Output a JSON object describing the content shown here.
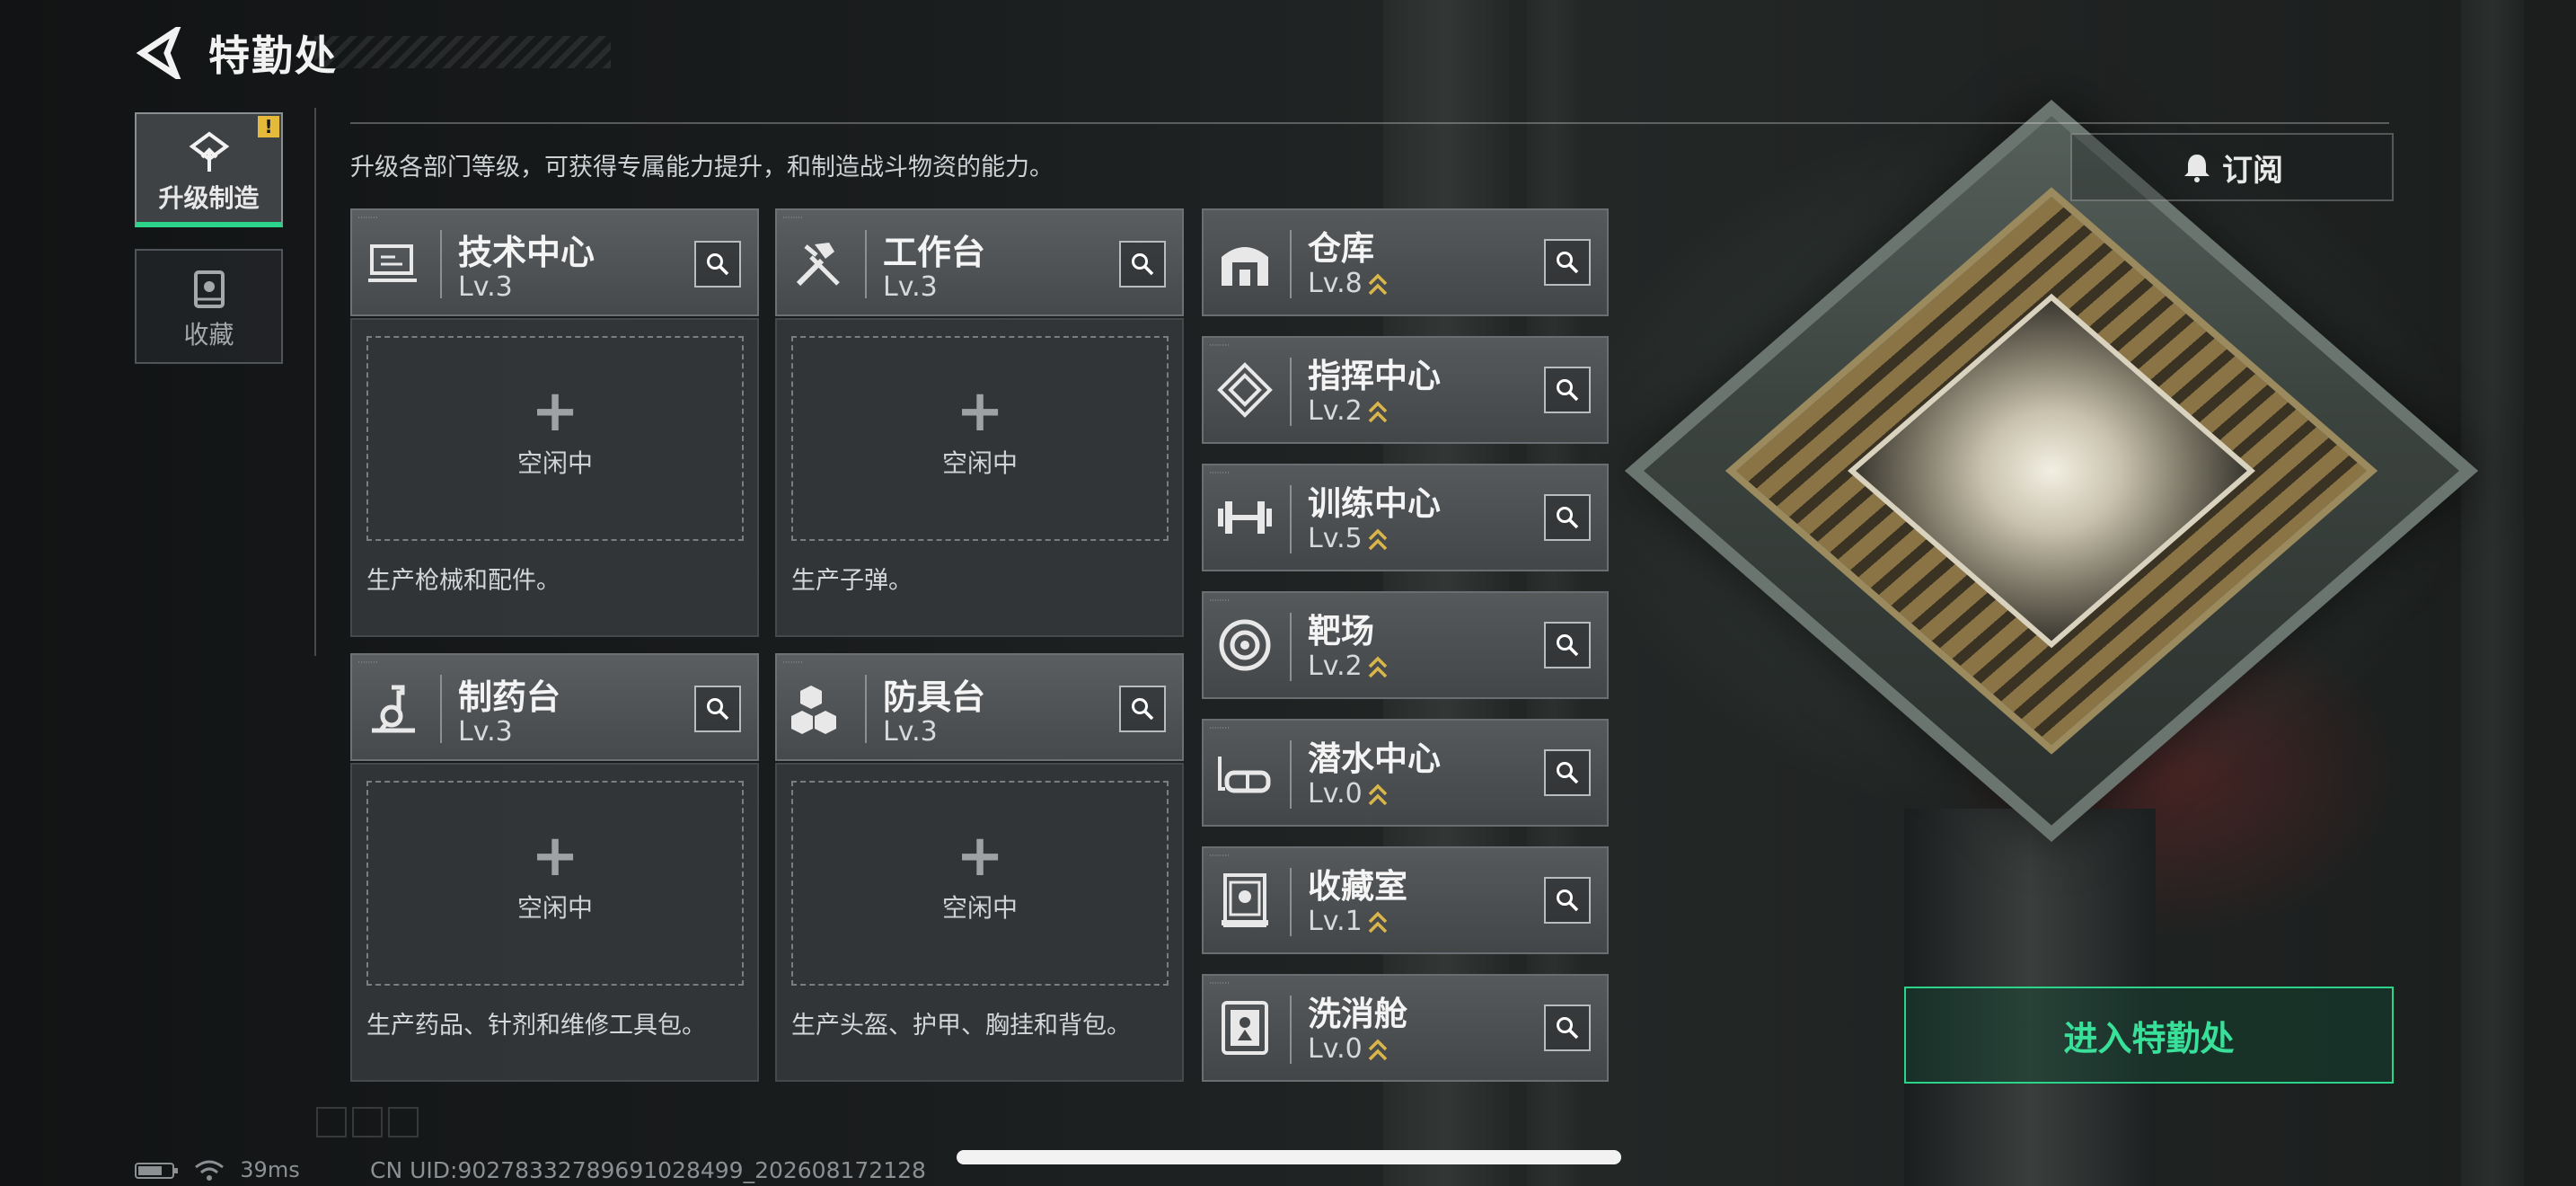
{
  "header": {
    "title": "特勤处",
    "back_icon": "back-arrow-icon"
  },
  "tabs": [
    {
      "label": "升级制造",
      "icon": "upgrade-icon",
      "active": true,
      "badge": "!"
    },
    {
      "label": "收藏",
      "icon": "collection-icon",
      "active": false
    }
  ],
  "description": "升级各部门等级，可获得专属能力提升，和制造战斗物资的能力。",
  "subscribe_label": "订阅",
  "workstations": [
    {
      "name": "技术中心",
      "level": "Lv.3",
      "slot_plus": "+",
      "slot_status": "空闲中",
      "desc": "生产枪械和配件。",
      "icon": "tech-center-icon"
    },
    {
      "name": "工作台",
      "level": "Lv.3",
      "slot_plus": "+",
      "slot_status": "空闲中",
      "desc": "生产子弹。",
      "icon": "workbench-icon"
    },
    {
      "name": "制药台",
      "level": "Lv.3",
      "slot_plus": "+",
      "slot_status": "空闲中",
      "desc": "生产药品、针剂和维修工具包。",
      "icon": "pharmacy-icon"
    },
    {
      "name": "防具台",
      "level": "Lv.3",
      "slot_plus": "+",
      "slot_status": "空闲中",
      "desc": "生产头盔、护甲、胸挂和背包。",
      "icon": "armor-bench-icon"
    }
  ],
  "departments": [
    {
      "name": "仓库",
      "level": "Lv.8",
      "icon": "warehouse-icon"
    },
    {
      "name": "指挥中心",
      "level": "Lv.2",
      "icon": "command-center-icon"
    },
    {
      "name": "训练中心",
      "level": "Lv.5",
      "icon": "training-center-icon"
    },
    {
      "name": "靶场",
      "level": "Lv.2",
      "icon": "shooting-range-icon"
    },
    {
      "name": "潜水中心",
      "level": "Lv.0",
      "icon": "diving-center-icon"
    },
    {
      "name": "收藏室",
      "level": "Lv.1",
      "icon": "collection-room-icon"
    },
    {
      "name": "洗消舱",
      "level": "Lv.0",
      "icon": "decon-chamber-icon"
    }
  ],
  "enter_button": "进入特勤处",
  "status_bar": {
    "ping": "39ms",
    "uid": "CN UID:90278332789691028499_202608172128"
  },
  "colors": {
    "accent_green": "#2bd48a",
    "warning_yellow": "#e5b93a",
    "upgrade_arrow": "#d9b54a"
  }
}
